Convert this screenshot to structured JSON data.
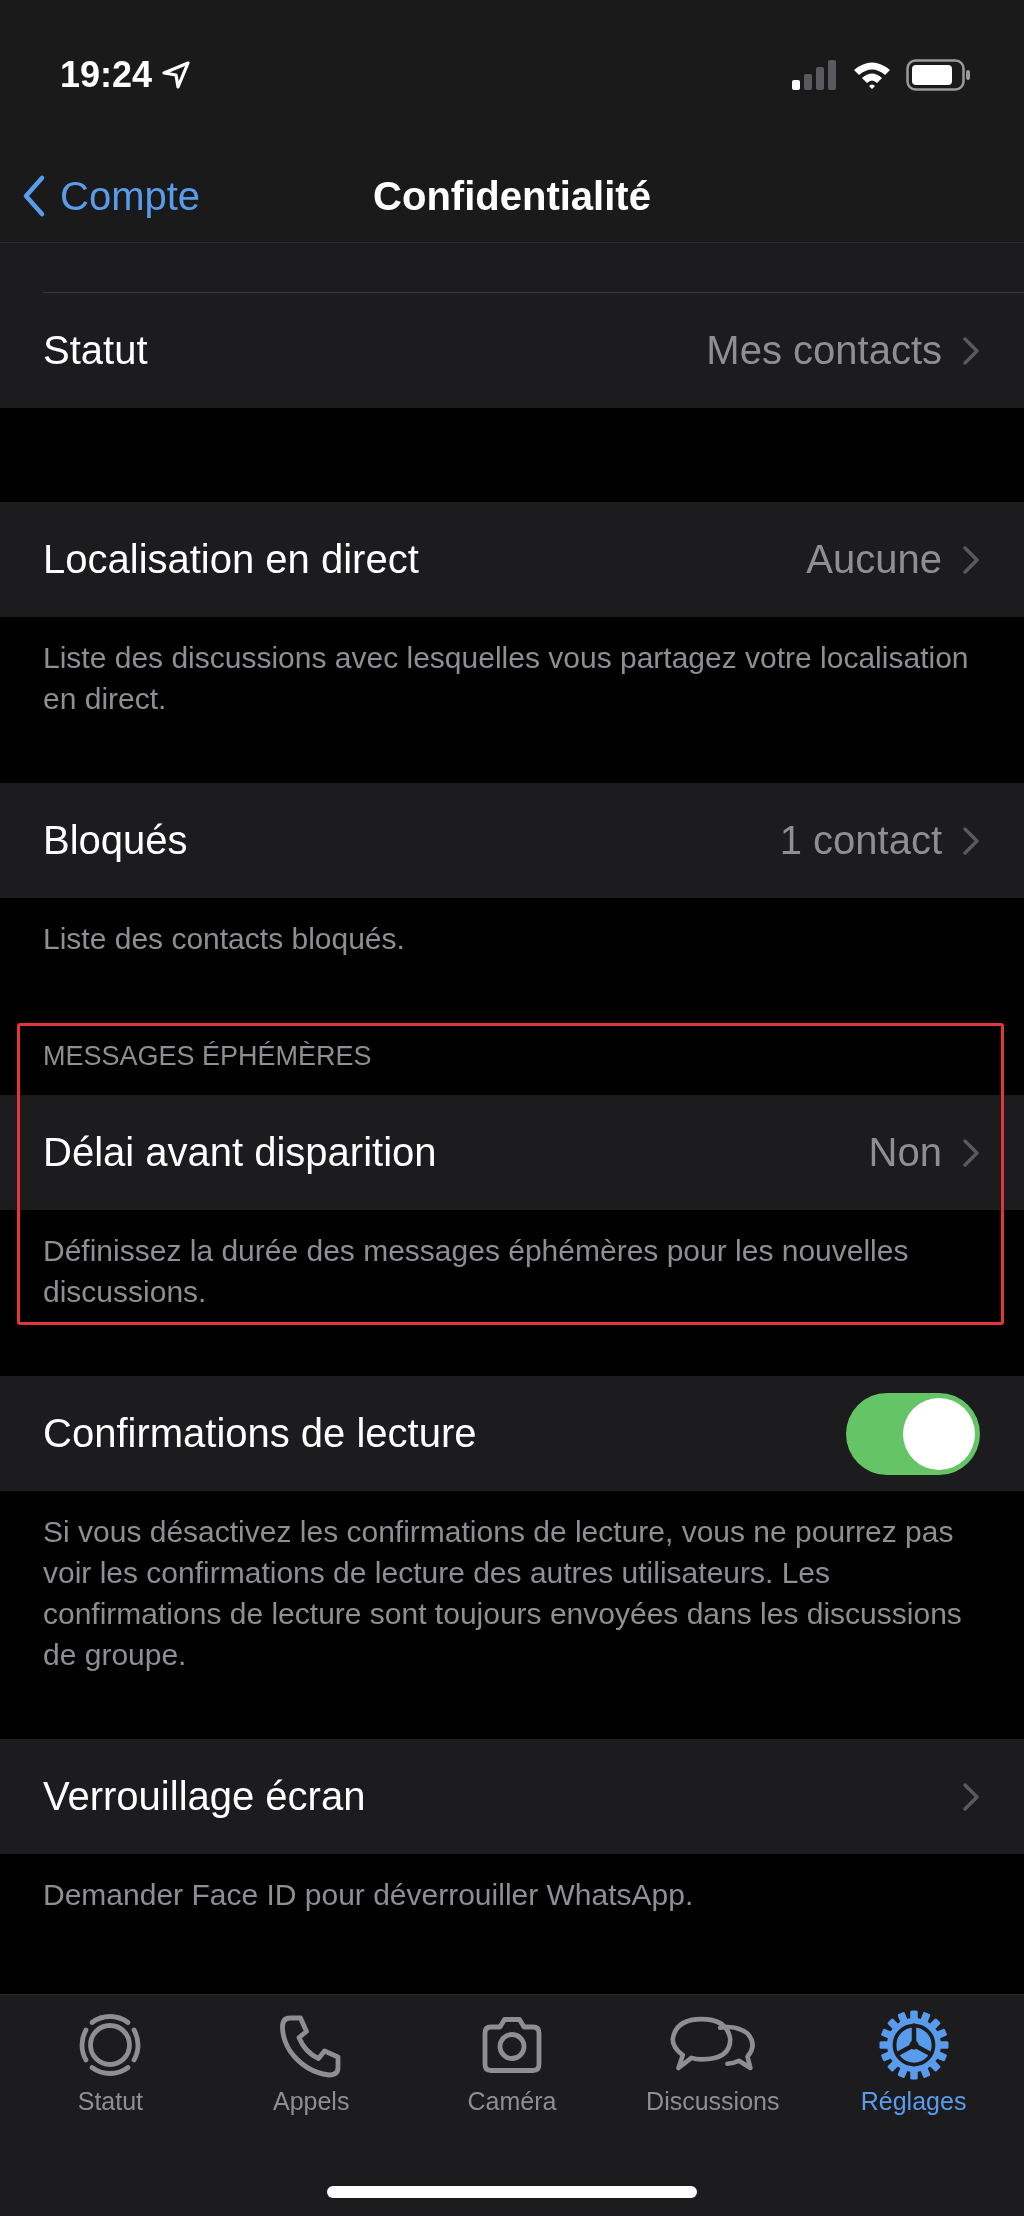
{
  "status_bar": {
    "time": "19:24"
  },
  "nav": {
    "back_label": "Compte",
    "title": "Confidentialité"
  },
  "sections": [
    {
      "highlighted": false,
      "rows": [
        {
          "kind": "link",
          "label": "Statut",
          "value": "Mes contacts"
        }
      ]
    },
    {
      "highlighted": false,
      "rows": [
        {
          "kind": "link",
          "label": "Localisation en direct",
          "value": "Aucune"
        }
      ],
      "footer": "Liste des discussions avec lesquelles vous partagez votre localisation en direct."
    },
    {
      "highlighted": false,
      "rows": [
        {
          "kind": "link",
          "label": "Bloqués",
          "value": "1 contact"
        }
      ],
      "footer": "Liste des contacts bloqués."
    },
    {
      "highlighted": true,
      "header": "MESSAGES ÉPHÉMÈRES",
      "rows": [
        {
          "kind": "link",
          "label": "Délai avant disparition",
          "value": "Non"
        }
      ],
      "footer": "Définissez la durée des messages éphémères pour les nouvelles discussions."
    },
    {
      "highlighted": false,
      "rows": [
        {
          "kind": "toggle",
          "label": "Confirmations de lecture",
          "on": true
        }
      ],
      "footer": "Si vous désactivez les confirmations de lecture, vous ne pourrez pas voir les confirmations de lecture des autres utilisateurs. Les confirmations de lecture sont toujours envoyées dans les discussions de groupe."
    },
    {
      "highlighted": false,
      "rows": [
        {
          "kind": "link",
          "label": "Verrouillage écran"
        }
      ],
      "footer": "Demander Face ID pour déverrouiller WhatsApp."
    }
  ],
  "tab_bar": [
    {
      "label": "Statut",
      "selected": false
    },
    {
      "label": "Appels",
      "selected": false
    },
    {
      "label": "Caméra",
      "selected": false
    },
    {
      "label": "Discussions",
      "selected": false
    },
    {
      "label": "Réglages",
      "selected": true
    }
  ]
}
